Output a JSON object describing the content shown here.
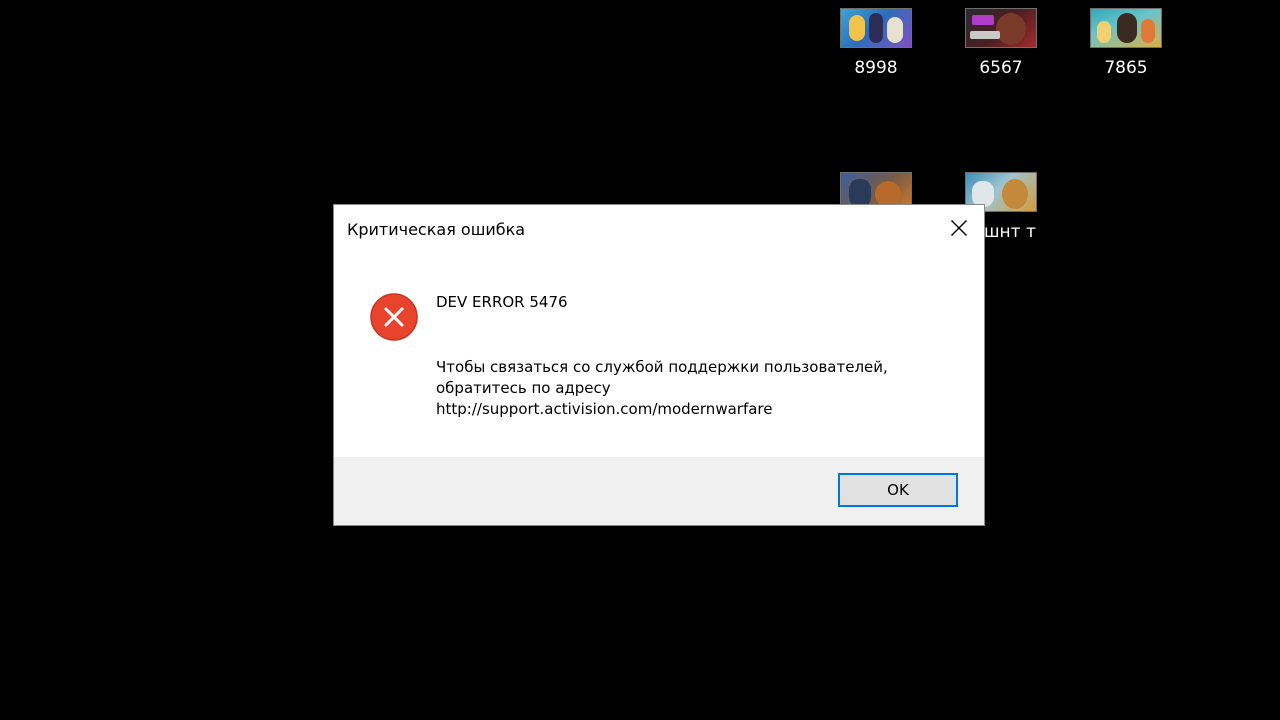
{
  "desktop": {
    "icons": [
      {
        "label": "8998",
        "thumb": "fortnite-thumbnail"
      },
      {
        "label": "6567",
        "thumb": "warzone-thumbnail"
      },
      {
        "label": "7865",
        "thumb": "game-thumbnail"
      },
      {
        "label": "",
        "thumb": "game-thumbnail"
      },
      {
        "label": "шнт т",
        "thumb": "game-thumbnail"
      }
    ]
  },
  "dialog": {
    "title": "Критическая ошибка",
    "heading": "DEV ERROR 5476",
    "body_lines": [
      "Чтобы связаться со службой поддержки пользователей,",
      "обратитесь по адресу",
      "http://support.activision.com/modernwarfare"
    ],
    "ok_label": "OK",
    "icon": "error-icon",
    "colors": {
      "error_red": "#e8432d",
      "focus_border": "#0078d7",
      "footer_bg": "#f0f0f0"
    }
  }
}
